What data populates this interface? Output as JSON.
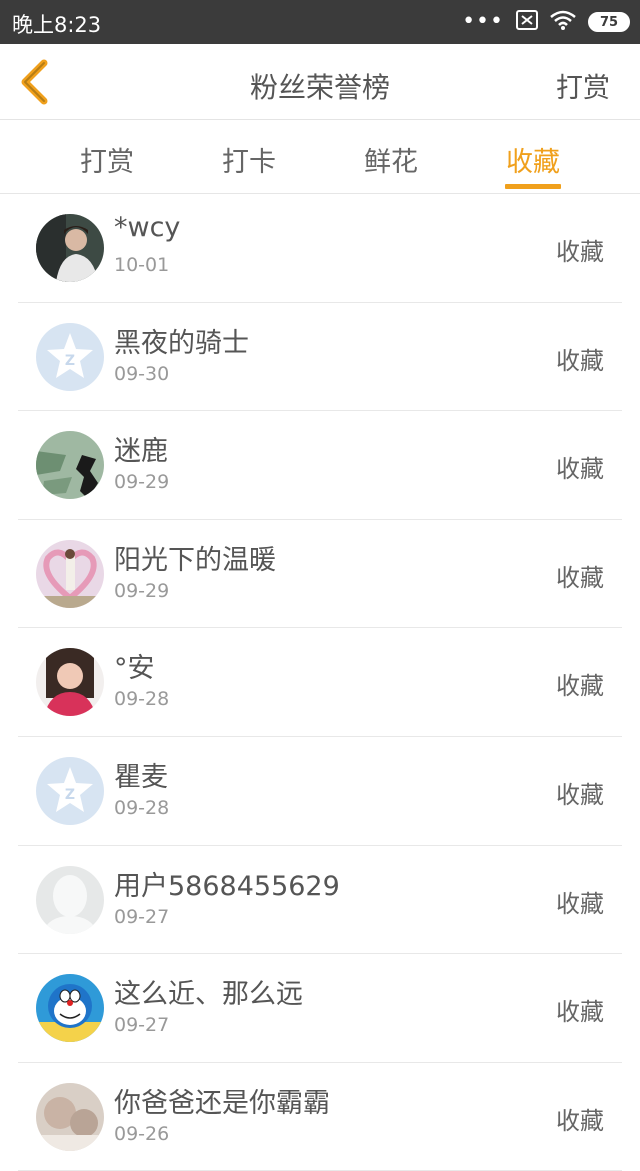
{
  "status_bar": {
    "time": "晚上8:23",
    "signal_dots": "•••",
    "battery": "75"
  },
  "nav": {
    "title": "粉丝荣誉榜",
    "action": "打赏",
    "accent_color": "#f0a01c"
  },
  "tabs": [
    {
      "label": "打赏",
      "active": false
    },
    {
      "label": "打卡",
      "active": false
    },
    {
      "label": "鲜花",
      "active": false
    },
    {
      "label": "收藏",
      "active": true
    }
  ],
  "list": [
    {
      "name": "*wcy",
      "date": "10-01",
      "action": "收藏",
      "avatar": "photo-boy-icon"
    },
    {
      "name": "黑夜的骑士",
      "date": "09-30",
      "action": "收藏",
      "avatar": "default-star-avatar-icon"
    },
    {
      "name": "迷鹿",
      "date": "09-29",
      "action": "收藏",
      "avatar": "photo-map-icon"
    },
    {
      "name": "阳光下的温暖",
      "date": "09-29",
      "action": "收藏",
      "avatar": "photo-heart-icon"
    },
    {
      "name": "°安",
      "date": "09-28",
      "action": "收藏",
      "avatar": "photo-girl-icon"
    },
    {
      "name": "瞿麦",
      "date": "09-28",
      "action": "收藏",
      "avatar": "default-star-avatar-icon"
    },
    {
      "name": "用户5868455629",
      "date": "09-27",
      "action": "收藏",
      "avatar": "default-person-avatar-icon"
    },
    {
      "name": "这么近、那么远",
      "date": "09-27",
      "action": "收藏",
      "avatar": "doraemon-avatar-icon"
    },
    {
      "name": "你爸爸还是你霸霸",
      "date": "09-26",
      "action": "收藏",
      "avatar": "photo-blur-icon"
    }
  ]
}
